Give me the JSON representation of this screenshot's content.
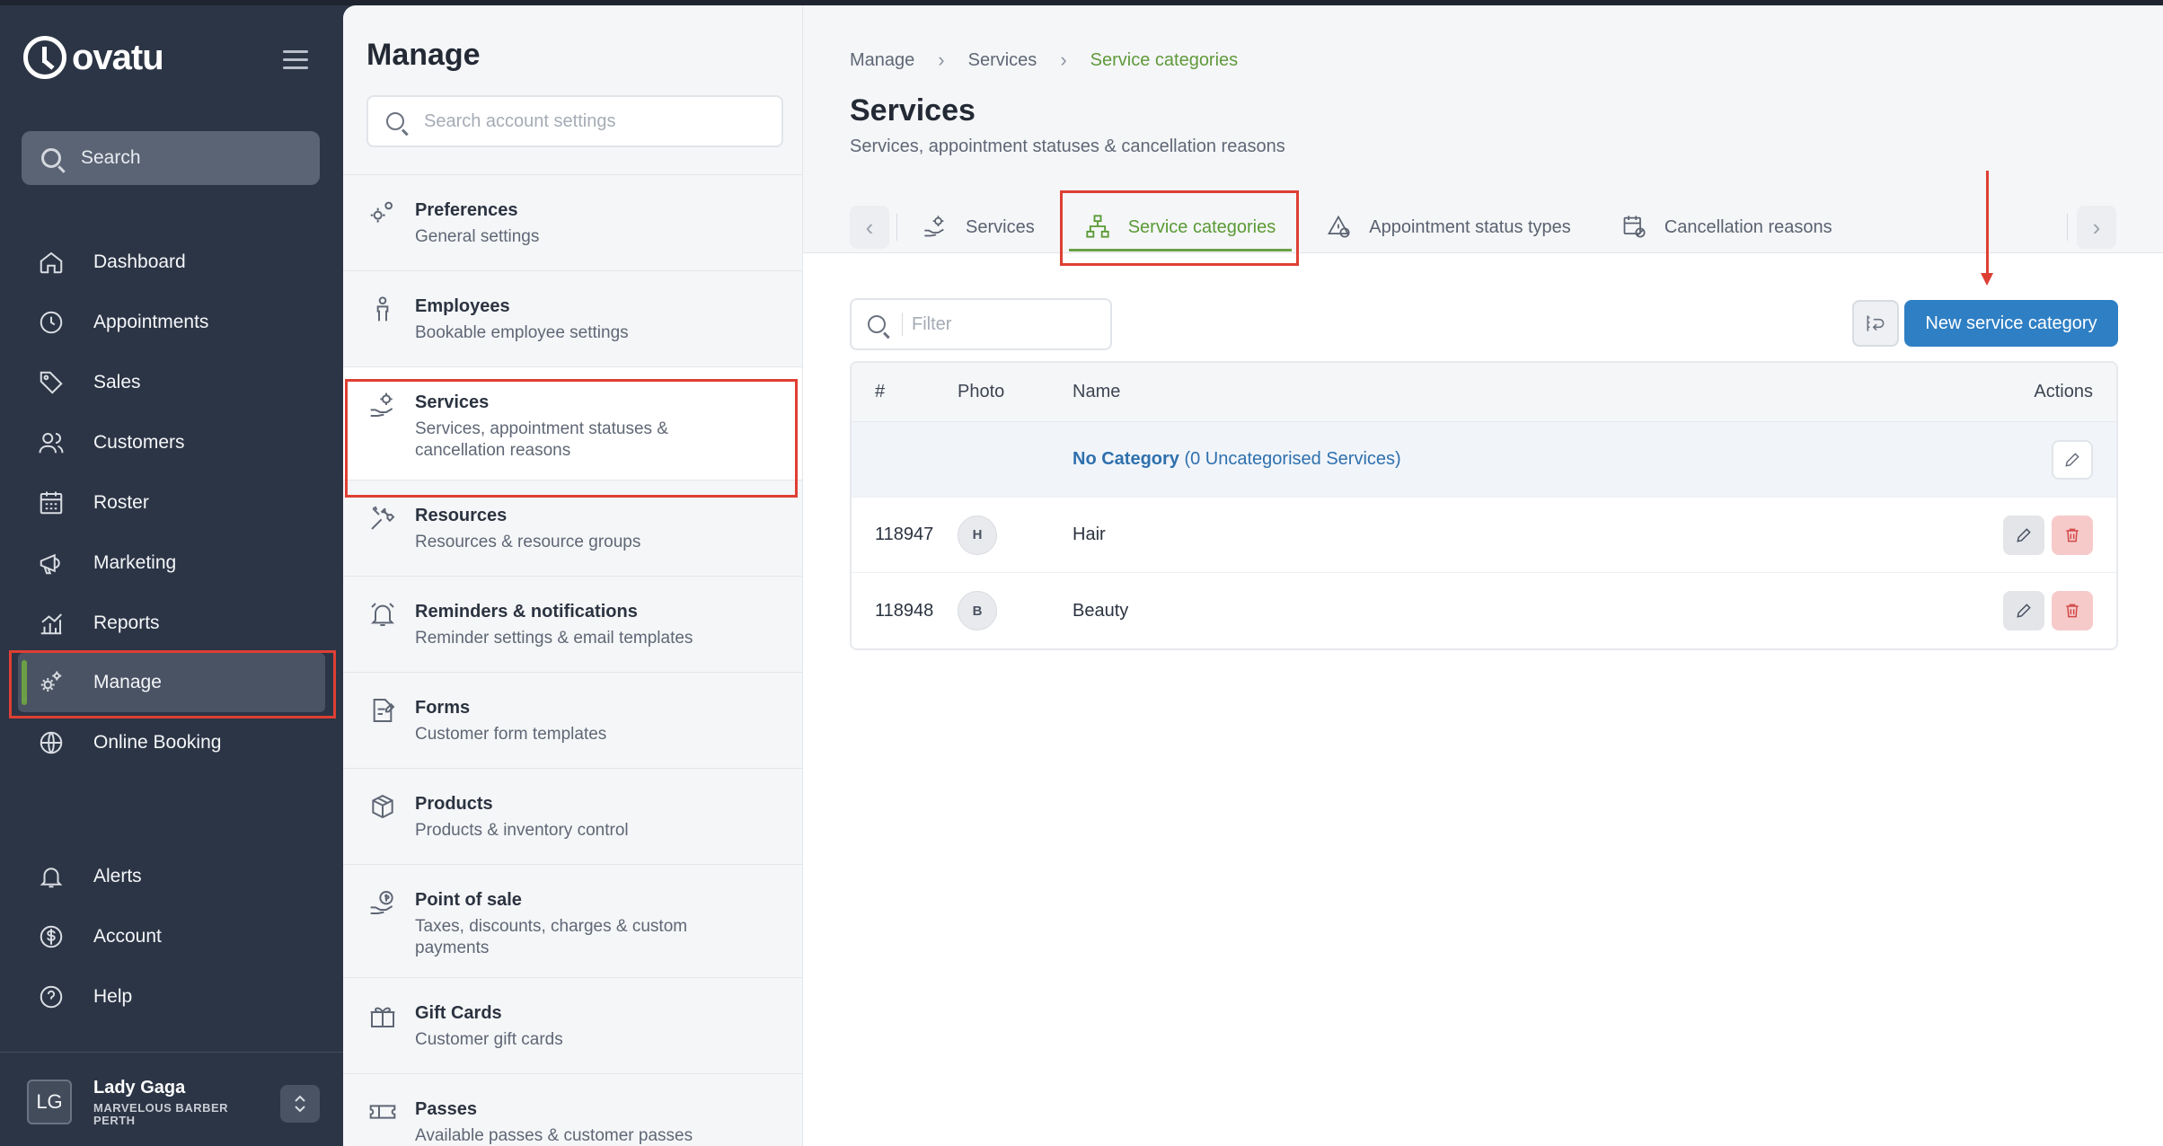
{
  "app": {
    "logo_text": "ovatu",
    "search_label": "Search"
  },
  "nav": {
    "items": [
      {
        "label": "Dashboard",
        "icon": "home-icon"
      },
      {
        "label": "Appointments",
        "icon": "clock-icon"
      },
      {
        "label": "Sales",
        "icon": "tag-icon"
      },
      {
        "label": "Customers",
        "icon": "users-icon"
      },
      {
        "label": "Roster",
        "icon": "calendar-grid-icon"
      },
      {
        "label": "Marketing",
        "icon": "megaphone-icon"
      },
      {
        "label": "Reports",
        "icon": "chart-icon"
      },
      {
        "label": "Manage",
        "icon": "gears-icon",
        "active": true
      },
      {
        "label": "Online Booking",
        "icon": "globe-icon"
      }
    ],
    "bottom_items": [
      {
        "label": "Alerts",
        "icon": "bell-icon"
      },
      {
        "label": "Account",
        "icon": "dollar-circle-icon"
      },
      {
        "label": "Help",
        "icon": "help-circle-icon"
      }
    ],
    "user": {
      "initials": "LG",
      "name": "Lady Gaga",
      "org": "MARVELOUS BARBER PERTH"
    }
  },
  "manage": {
    "title": "Manage",
    "search_placeholder": "Search account settings",
    "items": [
      {
        "title": "Preferences",
        "sub": "General settings"
      },
      {
        "title": "Employees",
        "sub": "Bookable employee settings"
      },
      {
        "title": "Services",
        "sub": "Services, appointment statuses & cancellation reasons",
        "active": true
      },
      {
        "title": "Resources",
        "sub": "Resources & resource groups"
      },
      {
        "title": "Reminders & notifications",
        "sub": "Reminder settings & email templates"
      },
      {
        "title": "Forms",
        "sub": "Customer form templates"
      },
      {
        "title": "Products",
        "sub": "Products & inventory control"
      },
      {
        "title": "Point of sale",
        "sub": "Taxes, discounts, charges & custom payments"
      },
      {
        "title": "Gift Cards",
        "sub": "Customer gift cards"
      },
      {
        "title": "Passes",
        "sub": "Available passes & customer passes"
      }
    ]
  },
  "main": {
    "breadcrumb": [
      "Manage",
      "Services",
      "Service categories"
    ],
    "title": "Services",
    "subtitle": "Services, appointment statuses & cancellation reasons",
    "tabs": [
      {
        "label": "Services",
        "icon": "gear-hand-icon"
      },
      {
        "label": "Service categories",
        "icon": "hierarchy-icon",
        "active": true
      },
      {
        "label": "Appointment status types",
        "icon": "status-icon"
      },
      {
        "label": "Cancellation reasons",
        "icon": "calendar-cancel-icon"
      }
    ],
    "filter_placeholder": "Filter",
    "new_button": "New service category",
    "table": {
      "headers": {
        "id": "#",
        "photo": "Photo",
        "name": "Name",
        "actions": "Actions"
      },
      "no_category": {
        "bold": "No Category",
        "rest": " (0 Uncategorised Services)"
      },
      "rows": [
        {
          "id": "118947",
          "initial": "H",
          "name": "Hair"
        },
        {
          "id": "118948",
          "initial": "B",
          "name": "Beauty"
        }
      ]
    }
  }
}
